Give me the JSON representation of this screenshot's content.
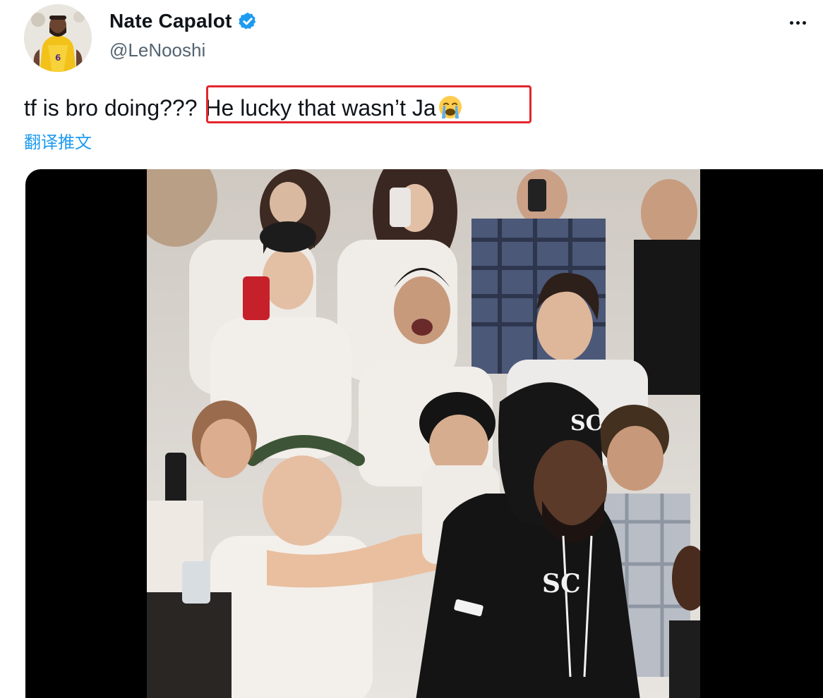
{
  "author": {
    "display_name": "Nate Capalot",
    "handle": "@LeNooshi",
    "verified": true,
    "avatar_icon": "player-avatar",
    "verified_icon": "verified-badge-icon"
  },
  "header": {
    "more_icon": "more-options-icon"
  },
  "tweet": {
    "text_prefix": "tf is bro doing???",
    "text_highlight": "He lucky that wasn’t Ja",
    "emoji": "loudly-crying-face",
    "translate_label": "翻译推文"
  },
  "media": {
    "type": "video-thumbnail",
    "description_icon": "crowd-photo"
  },
  "colors": {
    "text": "#0f1419",
    "secondary": "#536471",
    "link": "#1d9bf0",
    "highlight_border": "#e2262c",
    "verified": "#1d9bf0"
  }
}
